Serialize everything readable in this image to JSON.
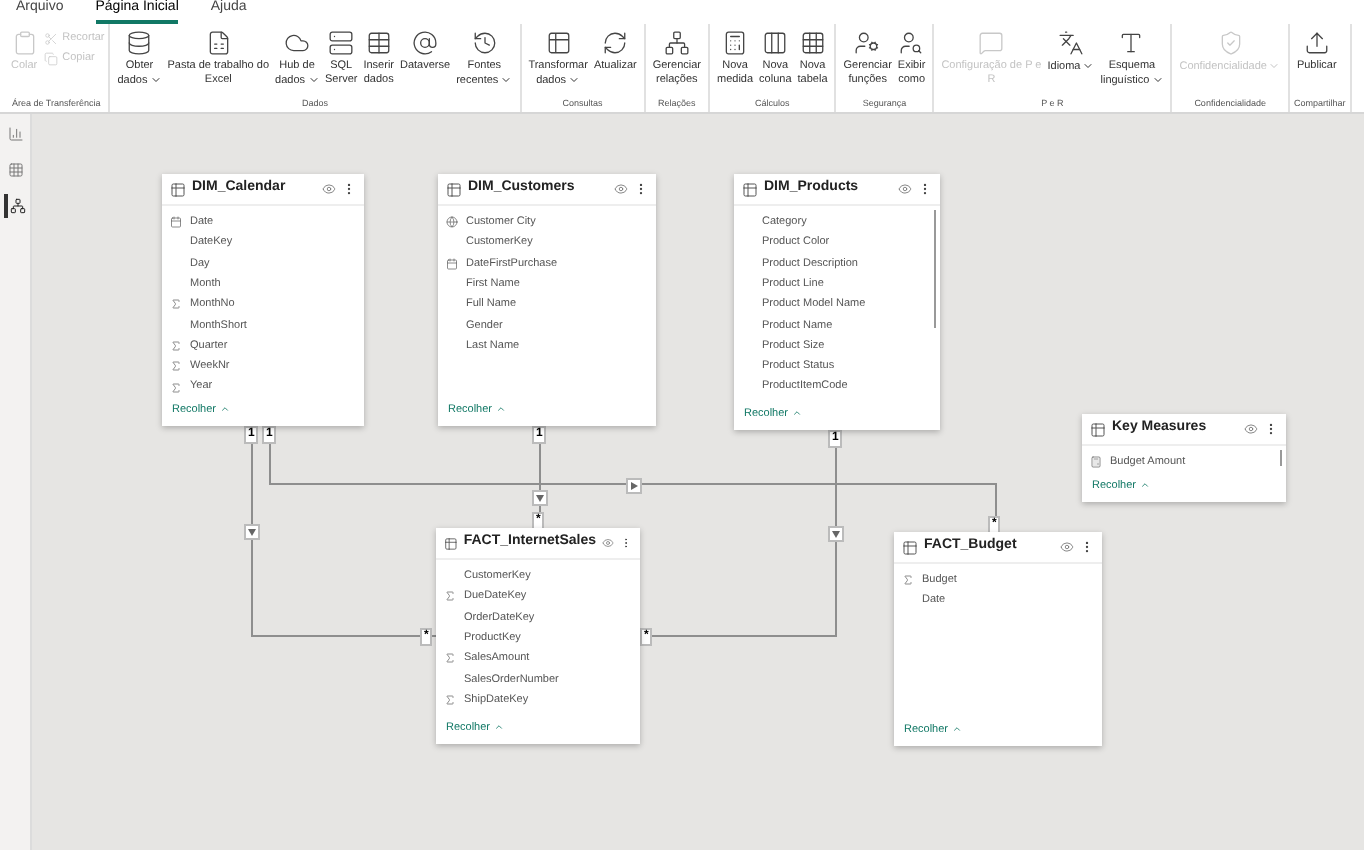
{
  "menu_tabs": [
    {
      "label": "Arquivo",
      "selected": false
    },
    {
      "label": "Página Inicial",
      "selected": true
    },
    {
      "label": "Ajuda",
      "selected": false
    }
  ],
  "ribbon_groups": [
    {
      "label": "Área de Transferência",
      "buttons": [
        {
          "kind": "paste",
          "label": "Colar",
          "disabled": true,
          "dropdown": false
        },
        {
          "kind": "cut",
          "label": "Recortar",
          "disabled": true
        },
        {
          "kind": "copy",
          "label": "Copiar",
          "disabled": true
        }
      ]
    },
    {
      "label": "Dados",
      "buttons": [
        {
          "kind": "database",
          "label": "Obter\ndados",
          "disabled": false,
          "dropdown": true
        },
        {
          "kind": "excel",
          "label": "Pasta de trabalho do\nExcel",
          "disabled": false,
          "dropdown": false
        },
        {
          "kind": "hub",
          "label": "Hub de\ndados",
          "disabled": false,
          "dropdown": true
        },
        {
          "kind": "sql",
          "label": "SQL\nServer",
          "disabled": false,
          "dropdown": false
        },
        {
          "kind": "insert",
          "label": "Inserir\ndados",
          "disabled": false,
          "dropdown": false
        },
        {
          "kind": "dataverse",
          "label": "Dataverse",
          "disabled": false,
          "dropdown": false
        },
        {
          "kind": "recent",
          "label": "Fontes\nrecentes",
          "disabled": false,
          "dropdown": true
        }
      ]
    },
    {
      "label": "Consultas",
      "buttons": [
        {
          "kind": "transform",
          "label": "Transformar\ndados",
          "disabled": false,
          "dropdown": true
        },
        {
          "kind": "refresh",
          "label": "Atualizar",
          "disabled": false,
          "dropdown": false
        }
      ]
    },
    {
      "label": "Relações",
      "buttons": [
        {
          "kind": "relations",
          "label": "Gerenciar\nrelações",
          "disabled": false,
          "dropdown": false
        }
      ]
    },
    {
      "label": "Cálculos",
      "buttons": [
        {
          "kind": "measure",
          "label": "Nova\nmedida",
          "disabled": false,
          "dropdown": false
        },
        {
          "kind": "column",
          "label": "Nova\ncoluna",
          "disabled": false,
          "dropdown": false
        },
        {
          "kind": "table",
          "label": "Nova\ntabela",
          "disabled": false,
          "dropdown": false
        }
      ]
    },
    {
      "label": "Segurança",
      "buttons": [
        {
          "kind": "roles",
          "label": "Gerenciar\nfunções",
          "disabled": false,
          "dropdown": false
        },
        {
          "kind": "viewas",
          "label": "Exibir\ncomo",
          "disabled": false,
          "dropdown": false
        }
      ]
    },
    {
      "label": "P e R",
      "buttons": [
        {
          "kind": "qa",
          "label": "Configuração de P e\nR",
          "disabled": true,
          "dropdown": false
        },
        {
          "kind": "language",
          "label": "Idioma",
          "disabled": false,
          "dropdown": true
        },
        {
          "kind": "linguistic",
          "label": "Esquema\nlinguístico",
          "disabled": false,
          "dropdown": true
        }
      ]
    },
    {
      "label": "Confidencialidade",
      "buttons": [
        {
          "kind": "sensitivity",
          "label": "Confidencialidade",
          "disabled": true,
          "dropdown": true
        }
      ]
    },
    {
      "label": "Compartilhar",
      "buttons": [
        {
          "kind": "publish",
          "label": "Publicar",
          "disabled": false,
          "dropdown": false
        }
      ]
    }
  ],
  "side_views": [
    {
      "kind": "report",
      "selected": false
    },
    {
      "kind": "data",
      "selected": false
    },
    {
      "kind": "model",
      "selected": true
    }
  ],
  "tables": [
    {
      "name": "DIM_Calendar",
      "collapse": "Recolher",
      "fields": [
        {
          "name": "Date",
          "kind": "calendar"
        },
        {
          "name": "DateKey",
          "kind": "text"
        },
        {
          "name": "Day",
          "kind": "text"
        },
        {
          "name": "Month",
          "kind": "text"
        },
        {
          "name": "MonthNo",
          "kind": "sum"
        },
        {
          "name": "MonthShort",
          "kind": "text"
        },
        {
          "name": "Quarter",
          "kind": "sum"
        },
        {
          "name": "WeekNr",
          "kind": "sum"
        },
        {
          "name": "Year",
          "kind": "sum"
        }
      ]
    },
    {
      "name": "DIM_Customers",
      "collapse": "Recolher",
      "fields": [
        {
          "name": "Customer City",
          "kind": "globe"
        },
        {
          "name": "CustomerKey",
          "kind": "text"
        },
        {
          "name": "DateFirstPurchase",
          "kind": "calendar"
        },
        {
          "name": "First Name",
          "kind": "text"
        },
        {
          "name": "Full Name",
          "kind": "text"
        },
        {
          "name": "Gender",
          "kind": "text"
        },
        {
          "name": "Last Name",
          "kind": "text"
        }
      ]
    },
    {
      "name": "DIM_Products",
      "collapse": "Recolher",
      "fields": [
        {
          "name": "Category",
          "kind": "text"
        },
        {
          "name": "Product Color",
          "kind": "text"
        },
        {
          "name": "Product Description",
          "kind": "text"
        },
        {
          "name": "Product Line",
          "kind": "text"
        },
        {
          "name": "Product Model Name",
          "kind": "text"
        },
        {
          "name": "Product Name",
          "kind": "text"
        },
        {
          "name": "Product Size",
          "kind": "text"
        },
        {
          "name": "Product Status",
          "kind": "text"
        },
        {
          "name": "ProductItemCode",
          "kind": "text"
        }
      ]
    },
    {
      "name": "Key Measures",
      "collapse": "Recolher",
      "fields": [
        {
          "name": "Budget Amount",
          "kind": "measure"
        }
      ]
    },
    {
      "name": "FACT_InternetSales",
      "collapse": "Recolher",
      "fields": [
        {
          "name": "CustomerKey",
          "kind": "text"
        },
        {
          "name": "DueDateKey",
          "kind": "sum"
        },
        {
          "name": "OrderDateKey",
          "kind": "text"
        },
        {
          "name": "ProductKey",
          "kind": "text"
        },
        {
          "name": "SalesAmount",
          "kind": "sum"
        },
        {
          "name": "SalesOrderNumber",
          "kind": "text"
        },
        {
          "name": "ShipDateKey",
          "kind": "sum"
        }
      ]
    },
    {
      "name": "FACT_Budget",
      "collapse": "Recolher",
      "fields": [
        {
          "name": "Budget",
          "kind": "sum"
        },
        {
          "name": "Date",
          "kind": "text"
        }
      ]
    }
  ],
  "relationships": [
    {
      "from_label": "1",
      "to_label": "*"
    },
    {
      "from_label": "1",
      "to_label": "*"
    },
    {
      "from_label": "1",
      "to_label": "*"
    },
    {
      "from_label": "1",
      "to_label": "*"
    }
  ]
}
